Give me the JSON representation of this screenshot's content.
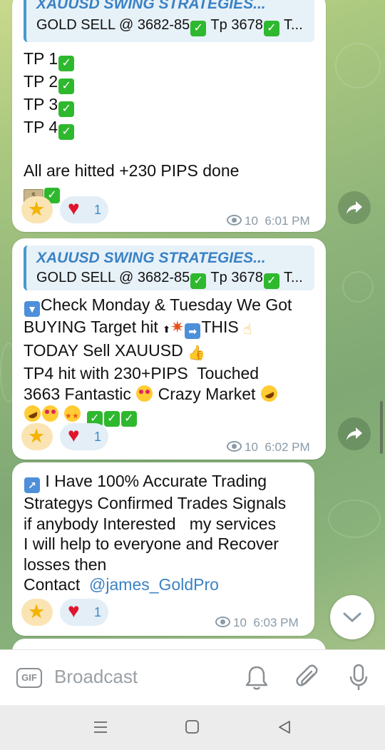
{
  "messages": [
    {
      "reply_title": "XAUUSD SWING STRATEGIES...",
      "reply_text_1": "GOLD SELL @ 3682-85",
      "reply_text_2": "  Tp 3678",
      "reply_text_3": " T...",
      "lines": [
        "TP 1",
        "TP 2",
        "TP 3",
        "TP 4",
        "",
        "All are hitted +230 PIPS done"
      ],
      "reactions": {
        "star_icon": "star",
        "heart_icon": "heart",
        "heart_count": "1"
      },
      "views": "10",
      "time": "6:01 PM"
    },
    {
      "reply_title": "XAUUSD SWING STRATEGIES...",
      "reply_text_1": "GOLD SELL @ 3682-85",
      "reply_text_2": "  Tp 3678",
      "reply_text_3": " T...",
      "line_1": "Check Monday & Tuesday We Got",
      "line_2a": "BUYING Target hit ",
      "line_2b": "THIS ",
      "line_3": "TODAY Sell XAUUSD ",
      "line_4": "TP4 hit with 230+PIPS  Touched",
      "line_5a": "3663 Fantastic ",
      "line_5b": " Crazy Market ",
      "reactions": {
        "heart_count": "1"
      },
      "views": "10",
      "time": "6:02 PM"
    },
    {
      "line_1": "I Have 100% Accurate Trading",
      "line_2": "Strategys Confirmed Trades Signals",
      "line_3": "if anybody Interested   my services",
      "line_4": "I will help to everyone and Recover",
      "line_5": "losses then",
      "line_6a": "Contact  ",
      "mention": "@james_GoldPro",
      "reactions": {
        "heart_count": "1"
      },
      "views": "10",
      "time": "6:03 PM"
    }
  ],
  "input": {
    "gif_label": "GIF",
    "placeholder": "Broadcast"
  },
  "icons": {
    "bell": "bell-icon",
    "attach": "paperclip-icon",
    "mic": "microphone-icon",
    "forward": "share-arrow-icon",
    "scroll": "chevron-down-icon",
    "nav_menu": "menu-icon",
    "nav_home": "home-square-icon",
    "nav_back": "back-triangle-icon"
  },
  "colors": {
    "accent": "#3a82c4",
    "check": "#2eb82e",
    "heart": "#e0152d",
    "star": "#f5b400"
  }
}
